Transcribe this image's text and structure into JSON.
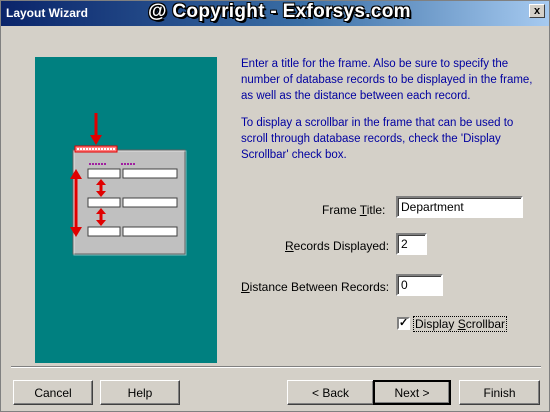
{
  "window": {
    "title": "Layout Wizard",
    "watermark": "@ Copyright - Exforsys.com",
    "close_glyph": "x"
  },
  "instructions": {
    "p1": "Enter a title for the frame. Also be sure to specify the number of database records to be displayed in the frame, as well as the distance between each record.",
    "p2": "To display a scrollbar in the frame that can be used to scroll through database records, check the 'Display Scrollbar' check box."
  },
  "form": {
    "frame_title": {
      "label_pre": "Frame ",
      "label_key": "T",
      "label_post": "itle:",
      "value": "Department"
    },
    "records_displayed": {
      "label_key": "R",
      "label_post": "ecords Displayed:",
      "value": "2"
    },
    "distance": {
      "label_key": "D",
      "label_post": "istance Between Records:",
      "value": "0"
    },
    "display_scrollbar": {
      "label_pre": "Display ",
      "label_key": "S",
      "label_post": "crollbar",
      "checked": true,
      "check_glyph": "✓"
    }
  },
  "buttons": {
    "cancel": "Cancel",
    "help": "Help",
    "back": "< Back",
    "next": "Next >",
    "finish": "Finish"
  },
  "colors": {
    "panel_bg": "#008080",
    "frame_accent": "#ff0000",
    "instruction_text": "#0000a0"
  }
}
